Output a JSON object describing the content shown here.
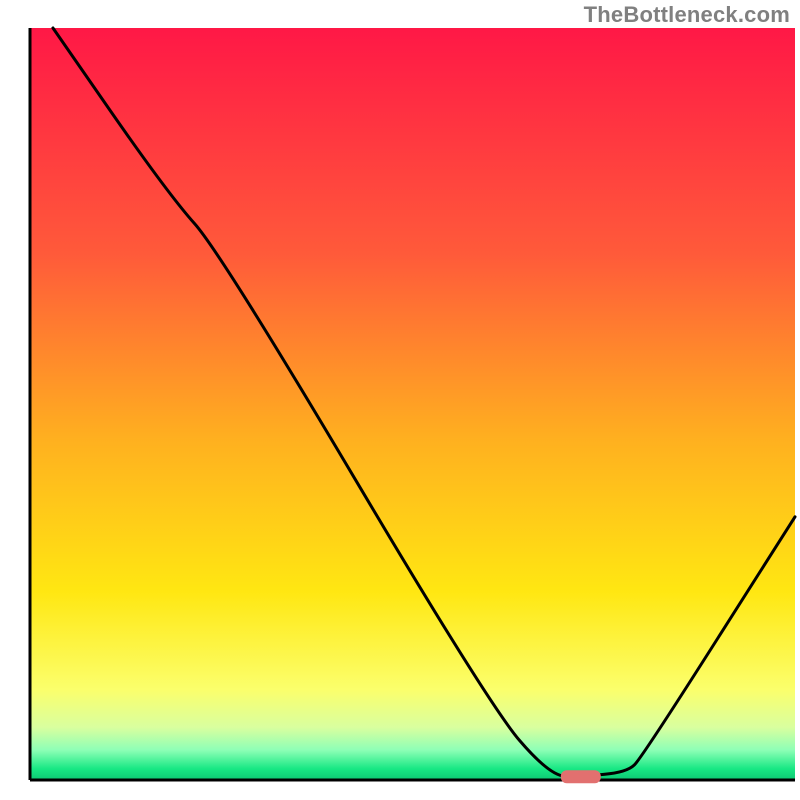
{
  "watermark": "TheBottleneck.com",
  "chart_data": {
    "type": "line",
    "title": "",
    "xlabel": "",
    "ylabel": "",
    "xlim": [
      0,
      100
    ],
    "ylim": [
      0,
      100
    ],
    "series": [
      {
        "name": "curve",
        "x": [
          3,
          18,
          25,
          60,
          68,
          72,
          78,
          80,
          100
        ],
        "values": [
          100,
          78,
          70,
          10,
          0.5,
          0.5,
          1,
          3,
          35
        ]
      }
    ],
    "marker": {
      "x": 72,
      "y": 0.5,
      "color": "#e2706f"
    },
    "gradient_bands": [
      {
        "stop": 0.0,
        "color": "#ff1846"
      },
      {
        "stop": 0.3,
        "color": "#ff5a3a"
      },
      {
        "stop": 0.55,
        "color": "#ffb11f"
      },
      {
        "stop": 0.75,
        "color": "#ffe712"
      },
      {
        "stop": 0.88,
        "color": "#fbff6c"
      },
      {
        "stop": 0.93,
        "color": "#d9ff9f"
      },
      {
        "stop": 0.96,
        "color": "#8effb6"
      },
      {
        "stop": 0.985,
        "color": "#18e884"
      },
      {
        "stop": 1.0,
        "color": "#0dc873"
      }
    ],
    "axis_color": "#000000"
  }
}
